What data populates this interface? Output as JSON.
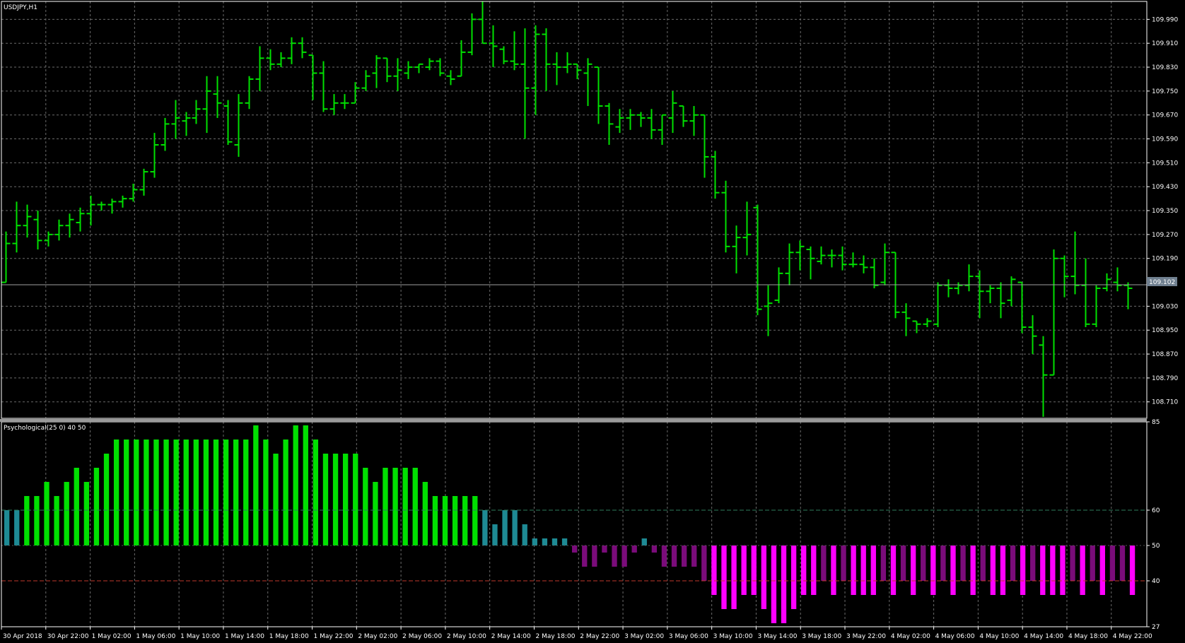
{
  "window": {
    "symbol_title": "USDJPY,H1",
    "indicator_title": "Psychological(25 0) 40 50",
    "current_price": "109.102"
  },
  "colors": {
    "background": "#000000",
    "grid": "#6b6b6b",
    "bars": "#00e000",
    "separator": "#9a9a9a",
    "current_price_tag": "#708090",
    "indicator_strong_up": "#00e000",
    "indicator_weak_up": "#1e8a94",
    "indicator_strong_down": "#ff00ff",
    "indicator_weak_down": "#7a0c7a",
    "level_60": "#2e7d5b",
    "level_40": "#c0392b"
  },
  "price_axis": {
    "ticks": [
      "109.990",
      "109.910",
      "109.830",
      "109.750",
      "109.670",
      "109.590",
      "109.510",
      "109.430",
      "109.350",
      "109.270",
      "109.190",
      "109.030",
      "108.950",
      "108.870",
      "108.790",
      "108.710"
    ]
  },
  "indicator_axis": {
    "ticks": [
      "85",
      "60",
      "50",
      "40",
      "27"
    ]
  },
  "time_axis": {
    "labels": [
      "30 Apr 2018",
      "30 Apr 22:00",
      "1 May 02:00",
      "1 May 06:00",
      "1 May 10:00",
      "1 May 14:00",
      "1 May 18:00",
      "1 May 22:00",
      "2 May 02:00",
      "2 May 06:00",
      "2 May 10:00",
      "2 May 14:00",
      "2 May 18:00",
      "2 May 22:00",
      "3 May 02:00",
      "3 May 06:00",
      "3 May 10:00",
      "3 May 14:00",
      "3 May 18:00",
      "3 May 22:00",
      "4 May 02:00",
      "4 May 06:00",
      "4 May 10:00",
      "4 May 14:00",
      "4 May 18:00",
      "4 May 22:00"
    ]
  },
  "chart_data": [
    {
      "type": "ohlc",
      "symbol": "USDJPY",
      "timeframe": "H1",
      "current_price": 109.102,
      "ylim": [
        108.655,
        110.05
      ],
      "bars": [
        [
          109.11,
          109.28,
          109.11,
          109.24
        ],
        [
          109.24,
          109.38,
          109.21,
          109.3
        ],
        [
          109.3,
          109.37,
          109.26,
          109.33
        ],
        [
          109.32,
          109.35,
          109.22,
          109.25
        ],
        [
          109.25,
          109.28,
          109.23,
          109.27
        ],
        [
          109.27,
          109.32,
          109.25,
          109.3
        ],
        [
          109.3,
          109.34,
          109.26,
          109.32
        ],
        [
          109.31,
          109.36,
          109.28,
          109.34
        ],
        [
          109.34,
          109.4,
          109.3,
          109.37
        ],
        [
          109.37,
          109.38,
          109.35,
          109.37
        ],
        [
          109.37,
          109.39,
          109.34,
          109.38
        ],
        [
          109.38,
          109.4,
          109.36,
          109.39
        ],
        [
          109.39,
          109.44,
          109.38,
          109.42
        ],
        [
          109.42,
          109.49,
          109.4,
          109.48
        ],
        [
          109.48,
          109.61,
          109.46,
          109.57
        ],
        [
          109.57,
          109.66,
          109.55,
          109.64
        ],
        [
          109.64,
          109.72,
          109.59,
          109.66
        ],
        [
          109.65,
          109.68,
          109.6,
          109.66
        ],
        [
          109.66,
          109.72,
          109.64,
          109.69
        ],
        [
          109.69,
          109.8,
          109.61,
          109.75
        ],
        [
          109.74,
          109.8,
          109.66,
          109.71
        ],
        [
          109.7,
          109.72,
          109.57,
          109.58
        ],
        [
          109.57,
          109.74,
          109.53,
          109.71
        ],
        [
          109.71,
          109.8,
          109.69,
          109.79
        ],
        [
          109.79,
          109.9,
          109.75,
          109.86
        ],
        [
          109.86,
          109.89,
          109.82,
          109.84
        ],
        [
          109.84,
          109.88,
          109.83,
          109.86
        ],
        [
          109.86,
          109.93,
          109.84,
          109.91
        ],
        [
          109.91,
          109.93,
          109.86,
          109.88
        ],
        [
          109.87,
          109.87,
          109.72,
          109.81
        ],
        [
          109.81,
          109.85,
          109.68,
          109.69
        ],
        [
          109.69,
          109.74,
          109.67,
          109.71
        ],
        [
          109.71,
          109.74,
          109.69,
          109.71
        ],
        [
          109.71,
          109.78,
          109.71,
          109.76
        ],
        [
          109.76,
          109.82,
          109.75,
          109.8
        ],
        [
          109.81,
          109.87,
          109.76,
          109.86
        ],
        [
          109.86,
          109.86,
          109.78,
          109.8
        ],
        [
          109.8,
          109.86,
          109.75,
          109.82
        ],
        [
          109.81,
          109.85,
          109.79,
          109.83
        ],
        [
          109.83,
          109.84,
          109.81,
          109.84
        ],
        [
          109.83,
          109.86,
          109.82,
          109.85
        ],
        [
          109.85,
          109.86,
          109.8,
          109.81
        ],
        [
          109.8,
          109.82,
          109.77,
          109.79
        ],
        [
          109.8,
          109.92,
          109.8,
          109.88
        ],
        [
          109.88,
          110.01,
          109.87,
          109.99
        ],
        [
          109.99,
          110.05,
          109.91,
          109.91
        ],
        [
          109.91,
          109.97,
          109.83,
          109.9
        ],
        [
          109.89,
          109.9,
          109.84,
          109.85
        ],
        [
          109.85,
          109.95,
          109.82,
          109.84
        ],
        [
          109.84,
          109.96,
          109.59,
          109.76
        ],
        [
          109.76,
          109.97,
          109.67,
          109.94
        ],
        [
          109.94,
          109.96,
          109.75,
          109.84
        ],
        [
          109.84,
          109.88,
          109.77,
          109.83
        ],
        [
          109.83,
          109.88,
          109.81,
          109.84
        ],
        [
          109.84,
          109.84,
          109.79,
          109.82
        ],
        [
          109.81,
          109.86,
          109.7,
          109.84
        ],
        [
          109.83,
          109.83,
          109.64,
          109.7
        ],
        [
          109.7,
          109.71,
          109.57,
          109.64
        ],
        [
          109.63,
          109.69,
          109.61,
          109.66
        ],
        [
          109.66,
          109.69,
          109.62,
          109.67
        ],
        [
          109.67,
          109.68,
          109.63,
          109.66
        ],
        [
          109.66,
          109.69,
          109.59,
          109.62
        ],
        [
          109.62,
          109.67,
          109.57,
          109.67
        ],
        [
          109.66,
          109.75,
          109.61,
          109.71
        ],
        [
          109.7,
          109.7,
          109.63,
          109.65
        ],
        [
          109.65,
          109.7,
          109.6,
          109.67
        ],
        [
          109.67,
          109.67,
          109.46,
          109.53
        ],
        [
          109.53,
          109.55,
          109.39,
          109.41
        ],
        [
          109.41,
          109.45,
          109.21,
          109.23
        ],
        [
          109.23,
          109.3,
          109.14,
          109.26
        ],
        [
          109.26,
          109.38,
          109.2,
          109.27
        ],
        [
          109.36,
          109.37,
          109.0,
          109.02
        ],
        [
          109.03,
          109.1,
          108.93,
          109.04
        ],
        [
          109.05,
          109.16,
          109.04,
          109.14
        ],
        [
          109.14,
          109.24,
          109.1,
          109.21
        ],
        [
          109.21,
          109.25,
          109.15,
          109.23
        ],
        [
          109.22,
          109.23,
          109.12,
          109.19
        ],
        [
          109.18,
          109.23,
          109.17,
          109.2
        ],
        [
          109.2,
          109.22,
          109.16,
          109.2
        ],
        [
          109.2,
          109.23,
          109.15,
          109.17
        ],
        [
          109.17,
          109.21,
          109.16,
          109.17
        ],
        [
          109.17,
          109.2,
          109.14,
          109.16
        ],
        [
          109.16,
          109.19,
          109.09,
          109.1
        ],
        [
          109.11,
          109.24,
          109.1,
          109.21
        ],
        [
          109.21,
          109.21,
          108.99,
          109.01
        ],
        [
          109.01,
          109.04,
          108.93,
          108.99
        ],
        [
          108.98,
          108.98,
          108.94,
          108.97
        ],
        [
          108.97,
          108.99,
          108.96,
          108.98
        ],
        [
          108.97,
          109.11,
          108.96,
          109.1
        ],
        [
          109.1,
          109.12,
          109.06,
          109.09
        ],
        [
          109.09,
          109.11,
          109.07,
          109.1
        ],
        [
          109.1,
          109.17,
          109.08,
          109.13
        ],
        [
          109.13,
          109.15,
          108.99,
          109.08
        ],
        [
          109.08,
          109.1,
          109.04,
          109.09
        ],
        [
          109.09,
          109.11,
          108.99,
          109.04
        ],
        [
          109.05,
          109.13,
          109.03,
          109.12
        ],
        [
          109.11,
          109.11,
          108.94,
          108.96
        ],
        [
          108.96,
          109.0,
          108.87,
          108.93
        ],
        [
          108.9,
          108.93,
          108.66,
          108.8
        ],
        [
          108.8,
          109.22,
          108.8,
          109.19
        ],
        [
          109.19,
          109.2,
          109.06,
          109.13
        ],
        [
          109.13,
          109.28,
          109.07,
          109.1
        ],
        [
          109.1,
          109.19,
          108.96,
          108.97
        ],
        [
          108.97,
          109.1,
          108.96,
          109.09
        ],
        [
          109.09,
          109.14,
          109.08,
          109.12
        ],
        [
          109.11,
          109.16,
          109.08,
          109.1
        ],
        [
          109.1,
          109.11,
          109.02,
          109.09
        ]
      ]
    },
    {
      "type": "bar",
      "name": "Psychological(25 0) 40 50",
      "baseline": 50,
      "levels": [
        60,
        50,
        40
      ],
      "ylim": [
        27,
        85
      ],
      "values": [
        60,
        60,
        64,
        64,
        68,
        64,
        68,
        72,
        68,
        72,
        76,
        80,
        80,
        80,
        80,
        80,
        80,
        80,
        80,
        80,
        80,
        80,
        80,
        80,
        80,
        84,
        80,
        76,
        80,
        84,
        84,
        80,
        76,
        76,
        76,
        76,
        72,
        68,
        72,
        72,
        72,
        72,
        68,
        64,
        64,
        64,
        64,
        64,
        60,
        56,
        60,
        60,
        56,
        52,
        52,
        52,
        52,
        48,
        44,
        44,
        48,
        44,
        44,
        48,
        52,
        48,
        44,
        44,
        44,
        44,
        40,
        36,
        32,
        32,
        36,
        36,
        32,
        28,
        28,
        32,
        36,
        36,
        40,
        36,
        40,
        36,
        36,
        36,
        40,
        36,
        40,
        36,
        40,
        36,
        40,
        36,
        40,
        36,
        40,
        36,
        36,
        40,
        36,
        40,
        36,
        36,
        36,
        40,
        36,
        40,
        36,
        40,
        40,
        36
      ]
    }
  ]
}
